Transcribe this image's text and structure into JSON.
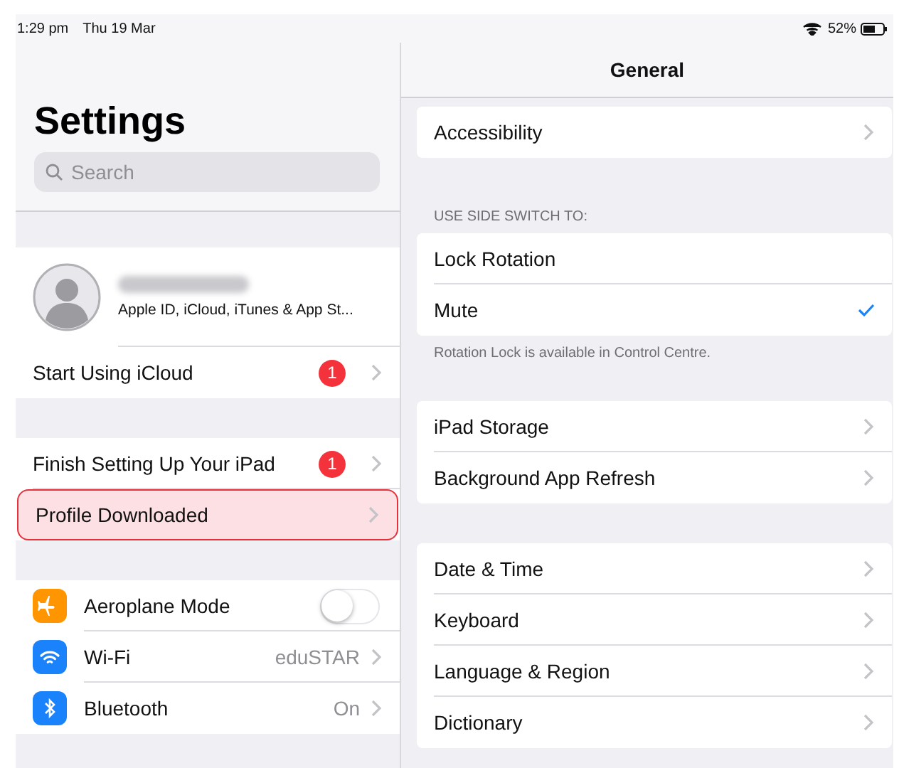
{
  "status_bar": {
    "time": "1:29 pm",
    "date": "Thu 19 Mar",
    "battery": "52%"
  },
  "sidebar": {
    "title": "Settings",
    "search": {
      "placeholder": "Search"
    },
    "groups": [
      {
        "rows": [
          {
            "kind": "profile",
            "subtitle": "Apple ID, iCloud, iTunes & App St..."
          },
          {
            "kind": "link",
            "label": "Start Using iCloud",
            "badge": "1",
            "highlighted": false
          }
        ]
      },
      {
        "rows": [
          {
            "kind": "link",
            "label": "Finish Setting Up Your iPad",
            "badge": "1",
            "highlighted": false
          },
          {
            "kind": "link",
            "label": "Profile Downloaded",
            "highlighted": true
          }
        ]
      },
      {
        "rows": [
          {
            "kind": "toggle",
            "label": "Aeroplane Mode",
            "on": false,
            "color": "#ff9500"
          },
          {
            "kind": "value",
            "label": "Wi-Fi",
            "value": "eduSTAR",
            "color": "#1a82fb"
          },
          {
            "kind": "value",
            "label": "Bluetooth",
            "value": "On",
            "color": "#1a82fb"
          }
        ]
      }
    ]
  },
  "detail": {
    "title": "General",
    "groups": [
      {
        "rows": [
          {
            "kind": "link",
            "label": "Accessibility"
          }
        ]
      },
      {
        "header": "USE SIDE SWITCH TO:",
        "footer": "Rotation Lock is available in Control Centre.",
        "rows": [
          {
            "kind": "option",
            "label": "Lock Rotation",
            "selected": false
          },
          {
            "kind": "option",
            "label": "Mute",
            "selected": true
          }
        ]
      },
      {
        "rows": [
          {
            "kind": "link",
            "label": "iPad Storage"
          },
          {
            "kind": "link",
            "label": "Background App Refresh"
          }
        ]
      },
      {
        "rows": [
          {
            "kind": "link",
            "label": "Date & Time"
          },
          {
            "kind": "link",
            "label": "Keyboard"
          },
          {
            "kind": "link",
            "label": "Language & Region"
          },
          {
            "kind": "link",
            "label": "Dictionary"
          }
        ]
      }
    ]
  }
}
